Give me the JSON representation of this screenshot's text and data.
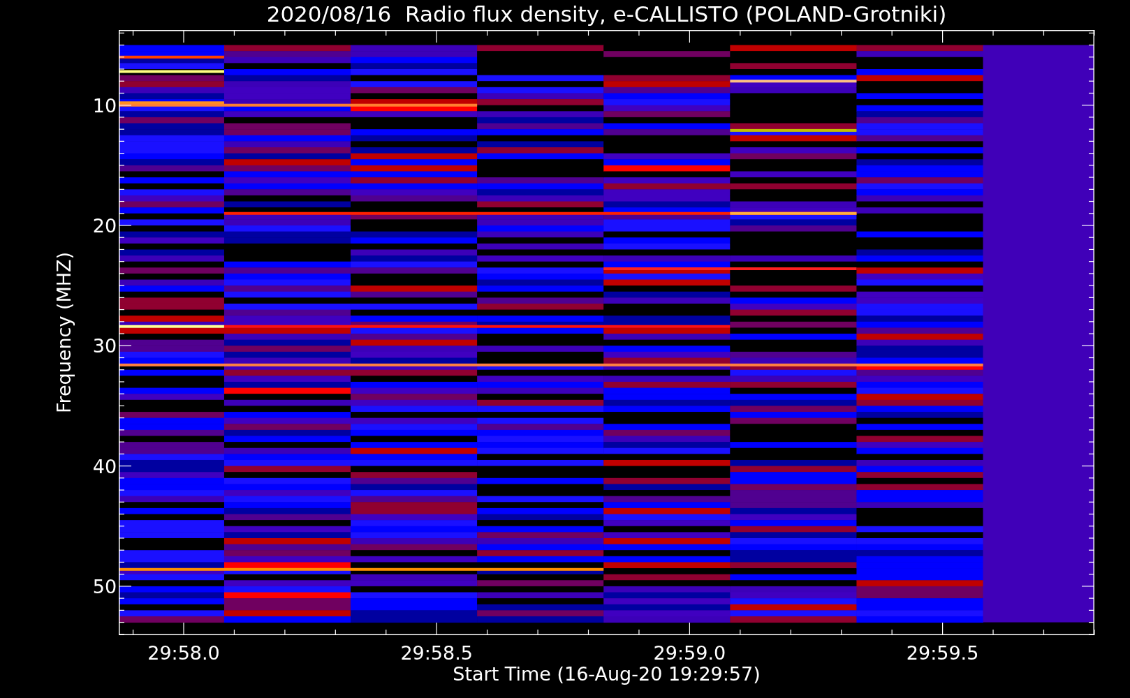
{
  "title": "2020/08/16  Radio flux density, e-CALLISTO (POLAND-Grotniki)",
  "y_axis": {
    "label": "Frequency (MHZ)",
    "ticks": [
      "10",
      "20",
      "30",
      "40",
      "50"
    ]
  },
  "x_axis": {
    "label": "Start Time (16-Aug-20 19:29:57)",
    "ticks": [
      "29:58.0",
      "29:58.5",
      "29:59.0",
      "29:59.5"
    ]
  }
}
